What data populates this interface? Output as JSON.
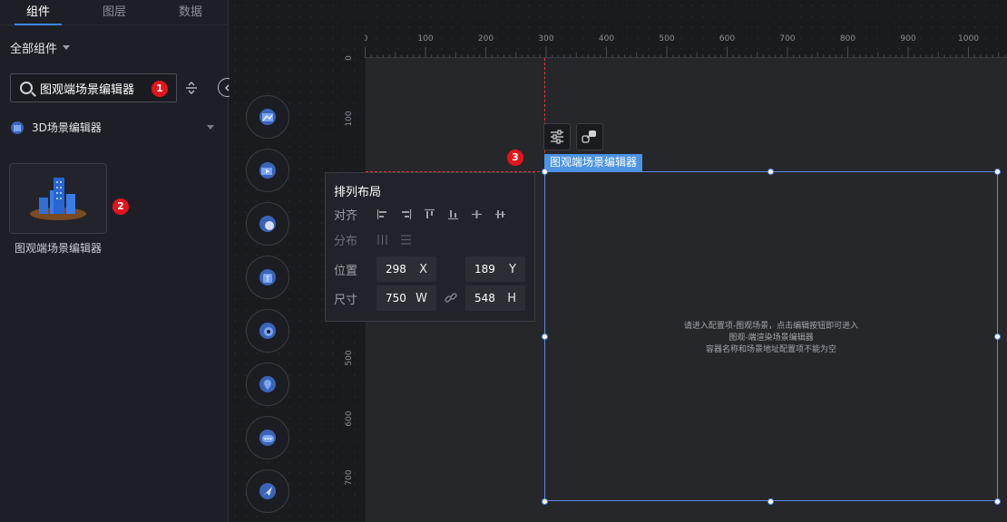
{
  "left_panel": {
    "tabs": [
      "组件",
      "图层",
      "数据"
    ],
    "filter_label": "全部组件",
    "search_value": "图观端场景编辑器",
    "group_label": "3D场景编辑器",
    "card_label": "图观端场景编辑器"
  },
  "badges": [
    "1",
    "2",
    "3"
  ],
  "ruler": {
    "x_ticks": [
      "0",
      "100",
      "200",
      "300",
      "400",
      "500",
      "600",
      "700",
      "800",
      "900",
      "1000"
    ],
    "y_ticks": [
      "0",
      "100",
      "500",
      "600",
      "700"
    ]
  },
  "selection": {
    "label": "图观端场景编辑器",
    "placeholder_lines": [
      "请进入配置项-图观场景，点击编辑按钮即可进入",
      "图观-端渲染场景编辑器",
      "容器名称和场景地址配置项不能为空"
    ]
  },
  "layout_popup": {
    "title": "排列布局",
    "align_label": "对齐",
    "distribute_label": "分布",
    "position_label": "位置",
    "size_label": "尺寸",
    "x_value": "298",
    "x_axis": "X",
    "y_value": "189",
    "y_axis": "Y",
    "w_value": "750",
    "w_axis": "W",
    "h_value": "548",
    "h_axis": "H"
  },
  "colors": {
    "accent": "#4a93e5",
    "badge": "#e3141b",
    "guide": "#e03a3a"
  },
  "icons": {
    "float_tools": [
      "image-icon",
      "video-icon",
      "globe-icon",
      "text-icon",
      "gear-icon",
      "location-icon",
      "chat-icon",
      "navigation-icon"
    ]
  }
}
